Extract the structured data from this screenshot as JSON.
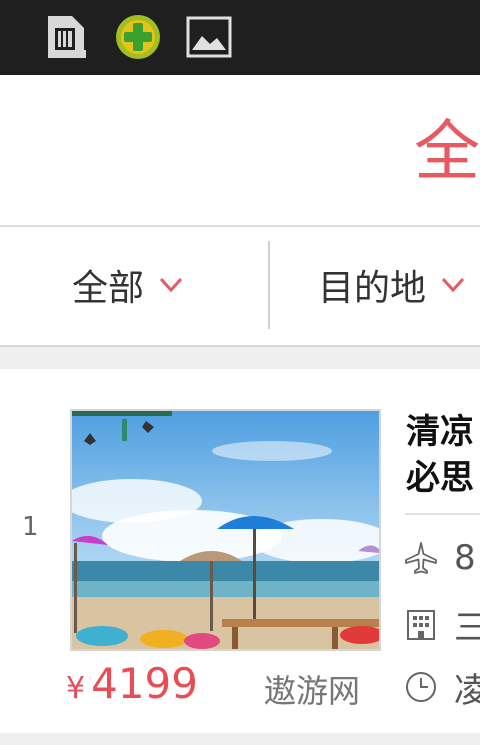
{
  "status_bar": {
    "icons": [
      "sim-card-icon",
      "360-security-icon",
      "image-icon"
    ]
  },
  "header": {
    "title": "全"
  },
  "filters": [
    {
      "label": "全部",
      "icon": "chevron-down-icon"
    },
    {
      "label": "目的地",
      "icon": "chevron-down-icon"
    }
  ],
  "listing": {
    "rank": "1",
    "title": "清凉\n必思",
    "price_currency": "¥",
    "price": "4199",
    "source": "遨游网",
    "info": [
      {
        "icon": "airplane-icon",
        "text": "8"
      },
      {
        "icon": "hotel-icon",
        "text": "三"
      },
      {
        "icon": "clock-icon",
        "text": "凌"
      }
    ]
  },
  "colors": {
    "accent": "#e85a62",
    "price": "#e84d55",
    "statusbar": "#1f1f1f"
  }
}
